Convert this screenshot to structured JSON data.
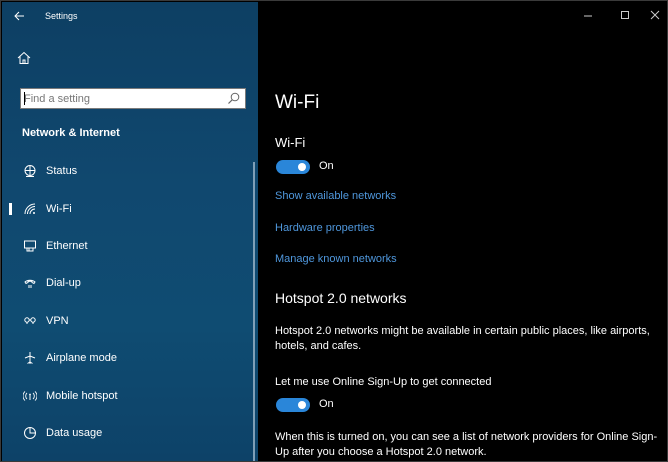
{
  "window": {
    "title": "Settings",
    "back_icon": "back-arrow-icon",
    "controls": [
      "minimize-icon",
      "maximize-icon",
      "close-icon"
    ]
  },
  "sidebar": {
    "home_icon": "home-icon",
    "search": {
      "placeholder": "Find a setting",
      "icon": "search-icon"
    },
    "section_title": "Network & Internet",
    "items": [
      {
        "label": "Status",
        "icon": "globe-status-icon",
        "selected": false
      },
      {
        "label": "Wi-Fi",
        "icon": "wifi-icon",
        "selected": true
      },
      {
        "label": "Ethernet",
        "icon": "ethernet-icon",
        "selected": false
      },
      {
        "label": "Dial-up",
        "icon": "dial-up-icon",
        "selected": false
      },
      {
        "label": "VPN",
        "icon": "vpn-icon",
        "selected": false
      },
      {
        "label": "Airplane mode",
        "icon": "airplane-icon",
        "selected": false
      },
      {
        "label": "Mobile hotspot",
        "icon": "hotspot-icon",
        "selected": false
      },
      {
        "label": "Data usage",
        "icon": "data-usage-icon",
        "selected": false
      }
    ]
  },
  "main": {
    "page_title": "Wi-Fi",
    "wifi_section_title": "Wi-Fi",
    "wifi_toggle": {
      "state": "On",
      "on": true
    },
    "links": {
      "show_networks": "Show available networks",
      "hardware": "Hardware properties",
      "manage": "Manage known networks"
    },
    "hotspot": {
      "heading": "Hotspot 2.0 networks",
      "description": "Hotspot 2.0 networks might be available in certain public places, like airports, hotels, and cafes.",
      "signup_label": "Let me use Online Sign-Up to get connected",
      "signup_toggle": {
        "state": "On",
        "on": true
      },
      "signup_description": "When this is turned on, you can see a list of network providers for Online Sign-Up after you choose a Hotspot 2.0 network."
    }
  },
  "colors": {
    "sidebar_bg": "#0f4a70",
    "accent": "#2a86d9",
    "link": "#4f97dc",
    "main_bg": "#000000"
  }
}
